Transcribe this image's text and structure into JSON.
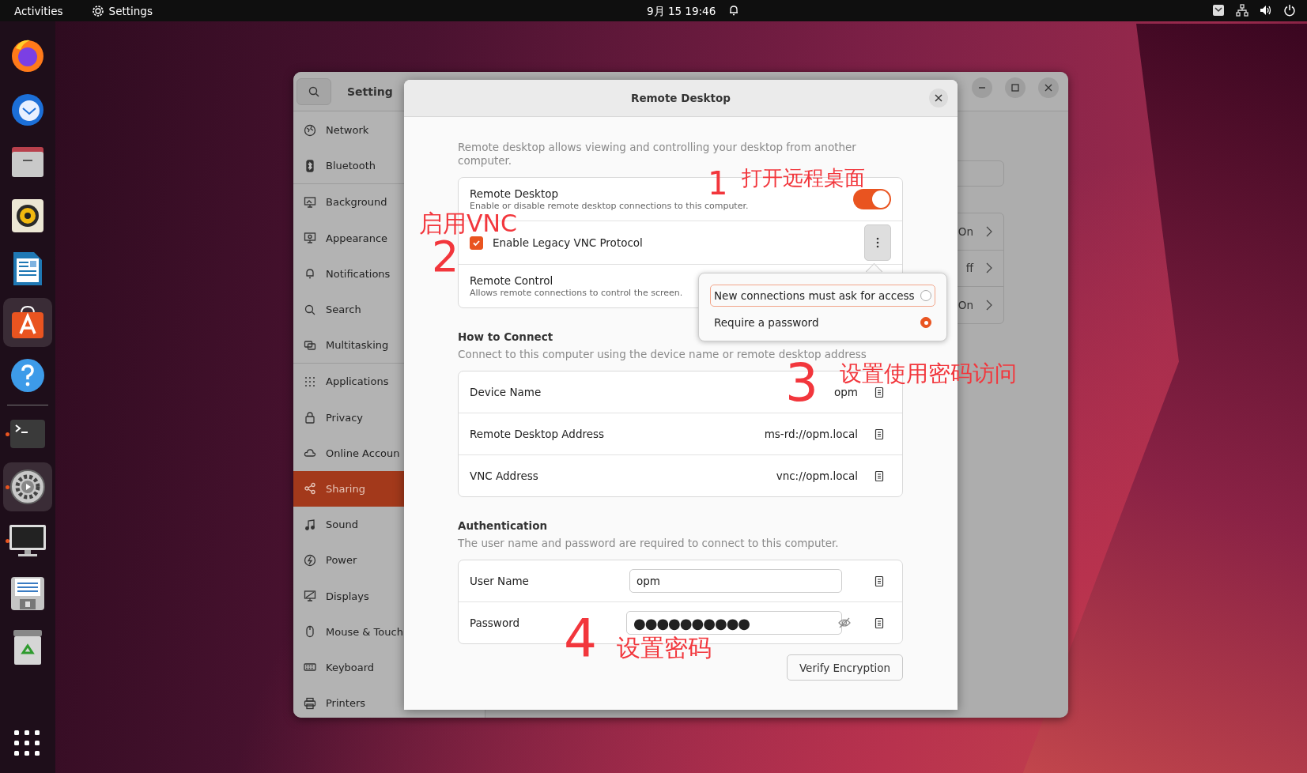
{
  "top_bar": {
    "activities": "Activities",
    "app_name": "Settings",
    "clock": "9月 15 19:46"
  },
  "dock": {
    "items": [
      {
        "kind": "firefox",
        "running": false,
        "highlighted": false
      },
      {
        "kind": "mail",
        "running": false,
        "highlighted": false
      },
      {
        "kind": "files",
        "running": false,
        "highlighted": false
      },
      {
        "kind": "speaker",
        "running": false,
        "highlighted": false
      },
      {
        "kind": "document",
        "running": false,
        "highlighted": false
      },
      {
        "kind": "store",
        "running": false,
        "highlighted": true
      },
      {
        "kind": "help",
        "running": false,
        "highlighted": false
      },
      {
        "kind": "terminal",
        "running": true,
        "highlighted": false
      },
      {
        "kind": "settings",
        "running": true,
        "highlighted": true
      },
      {
        "kind": "monitor",
        "running": true,
        "highlighted": false
      },
      {
        "kind": "disk",
        "running": false,
        "highlighted": false
      },
      {
        "kind": "trash",
        "running": false,
        "highlighted": false
      }
    ]
  },
  "settings_window": {
    "title": "Setting",
    "sidebar_groups": [
      [
        {
          "label": "Network",
          "selected": false
        },
        {
          "label": "Bluetooth",
          "selected": false
        }
      ],
      [
        {
          "label": "Background",
          "selected": false
        },
        {
          "label": "Appearance",
          "selected": false
        },
        {
          "label": "Notifications",
          "selected": false
        },
        {
          "label": "Search",
          "selected": false
        },
        {
          "label": "Multitasking",
          "selected": false
        }
      ],
      [
        {
          "label": "Applications",
          "selected": false
        },
        {
          "label": "Privacy",
          "selected": false
        },
        {
          "label": "Online Accoun",
          "selected": false
        },
        {
          "label": "Sharing",
          "selected": true
        },
        {
          "label": "Sound",
          "selected": false
        },
        {
          "label": "Power",
          "selected": false
        },
        {
          "label": "Displays",
          "selected": false
        },
        {
          "label": "Mouse & Touch",
          "selected": false
        },
        {
          "label": "Keyboard",
          "selected": false
        },
        {
          "label": "Printers",
          "selected": false
        }
      ]
    ],
    "rows": [
      {
        "value": "On"
      },
      {
        "value": "ff"
      },
      {
        "value": "On"
      }
    ]
  },
  "dialog": {
    "title": "Remote Desktop",
    "description": "Remote desktop allows viewing and controlling your desktop from another computer.",
    "options": [
      {
        "kind": "switch",
        "title": "Remote Desktop",
        "subtitle": "Enable or disable remote desktop connections to this computer.",
        "on": true
      },
      {
        "kind": "checkbox",
        "title": "Enable Legacy VNC Protocol",
        "checked": true
      },
      {
        "kind": "plain",
        "title": "Remote Control",
        "subtitle": "Allows remote connections to control the screen."
      }
    ],
    "popover": [
      {
        "label": "New connections must ask for access",
        "selected": false,
        "focused": true
      },
      {
        "label": "Require a password",
        "selected": true,
        "focused": false
      }
    ],
    "connect": {
      "heading": "How to Connect",
      "description": "Connect to this computer using the device name or remote desktop address",
      "rows": [
        {
          "label": "Device Name",
          "value": "opm"
        },
        {
          "label": "Remote Desktop Address",
          "value": "ms-rd://opm.local"
        },
        {
          "label": "VNC Address",
          "value": "vnc://opm.local"
        }
      ]
    },
    "auth": {
      "heading": "Authentication",
      "description": "The user name and password are required to connect to this computer.",
      "rows": [
        {
          "kind": "text",
          "label": "User Name",
          "value": "opm"
        },
        {
          "kind": "password",
          "label": "Password",
          "value": "●●●●●●●●●●"
        }
      ]
    },
    "verify_button": "Verify Encryption"
  },
  "annotations": [
    {
      "text": "1"
    },
    {
      "text": "打开远程桌面"
    },
    {
      "text": "启用VNC"
    },
    {
      "text": "2"
    },
    {
      "text": "3"
    },
    {
      "text": "设置使用密码访问"
    },
    {
      "text": "4"
    },
    {
      "text": "设置密码"
    }
  ]
}
